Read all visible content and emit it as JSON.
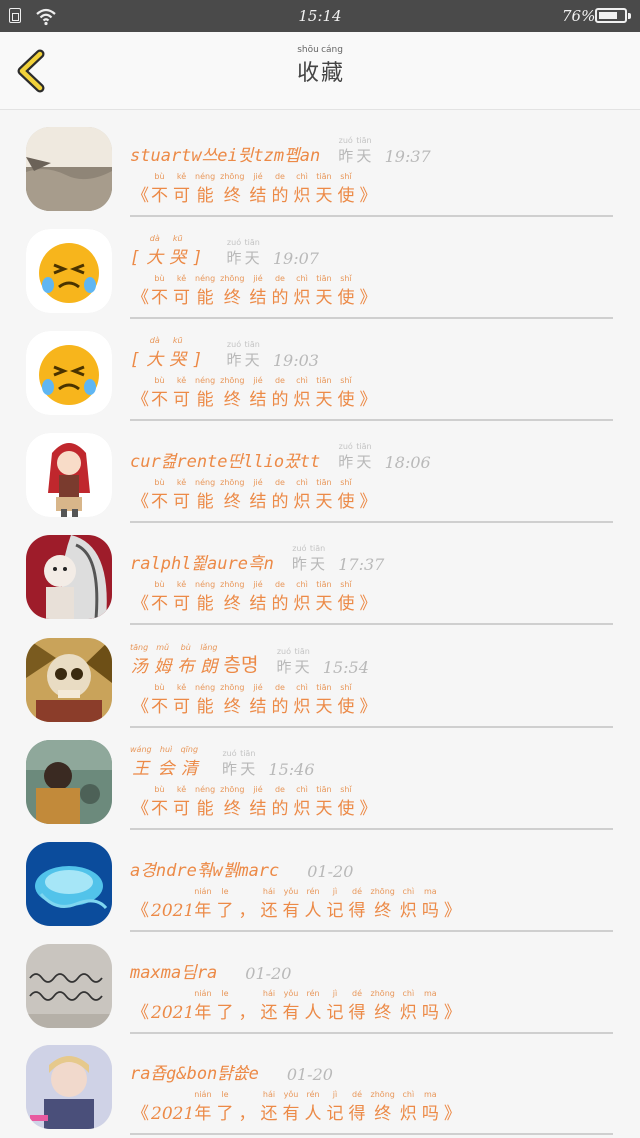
{
  "status_bar": {
    "time": "15:14",
    "battery": "76%",
    "battery_level": 0.76
  },
  "header": {
    "title_chars": [
      {
        "py": "shōu",
        "ch": "收"
      },
      {
        "py": "cáng",
        "ch": "藏"
      }
    ],
    "back_icon": "chevron-left-icon"
  },
  "colors": {
    "accent": "#ec8a47",
    "back_icon": "#f2d23a",
    "muted": "#b8b8b8"
  },
  "yesterday": [
    {
      "py": "zuó",
      "ch": "昨"
    },
    {
      "py": "tiān",
      "ch": "天"
    }
  ],
  "msg_angel": {
    "open": "《",
    "chars": [
      {
        "py": "bù",
        "ch": "不"
      },
      {
        "py": "kě",
        "ch": "可"
      },
      {
        "py": "néng",
        "ch": "能"
      },
      {
        "py": "zhōng",
        "ch": "终"
      },
      {
        "py": "jié",
        "ch": "结"
      },
      {
        "py": "de",
        "ch": "的"
      },
      {
        "py": "chì",
        "ch": "炽"
      },
      {
        "py": "tiān",
        "ch": "天"
      },
      {
        "py": "shǐ",
        "ch": "使"
      }
    ],
    "close": "》"
  },
  "msg_2021": {
    "open": "《",
    "num": "2021",
    "chars": [
      {
        "py": "nián",
        "ch": "年"
      },
      {
        "py": "le",
        "ch": "了"
      },
      {
        "py": "",
        "ch": "，"
      },
      {
        "py": "hái",
        "ch": "还"
      },
      {
        "py": "yǒu",
        "ch": "有"
      },
      {
        "py": "rén",
        "ch": "人"
      },
      {
        "py": "jì",
        "ch": "记"
      },
      {
        "py": "dé",
        "ch": "得"
      },
      {
        "py": "zhōng",
        "ch": "终"
      },
      {
        "py": "chì",
        "ch": "炽"
      },
      {
        "py": "ma",
        "ch": "吗"
      }
    ],
    "close": "》"
  },
  "items": [
    {
      "name": "stuartw쓰ei뮛tzm폡an",
      "show_yesterday": true,
      "time": "19:37",
      "msg": "angel",
      "avatar": "photo"
    },
    {
      "name_chars": [
        {
          "py": "",
          "ch": "["
        },
        {
          "py": "dà",
          "ch": "大"
        },
        {
          "py": "kū",
          "ch": "哭"
        },
        {
          "py": "",
          "ch": "]"
        }
      ],
      "show_yesterday": true,
      "time": "19:07",
      "msg": "angel",
      "avatar": "emoji-cry"
    },
    {
      "name_chars": [
        {
          "py": "",
          "ch": "["
        },
        {
          "py": "dà",
          "ch": "大"
        },
        {
          "py": "kū",
          "ch": "哭"
        },
        {
          "py": "",
          "ch": "]"
        }
      ],
      "show_yesterday": true,
      "time": "19:03",
      "msg": "angel",
      "avatar": "emoji-cry"
    },
    {
      "name": "cur켪rente딴llio꿌tt",
      "show_yesterday": true,
      "time": "18:06",
      "msg": "angel",
      "avatar": "anime-girl"
    },
    {
      "name": "ralphl쬝aure흑n",
      "show_yesterday": true,
      "time": "17:37",
      "msg": "angel",
      "avatar": "ink-girl"
    },
    {
      "name_chars": [
        {
          "py": "tāng",
          "ch": "汤"
        },
        {
          "py": "mǔ",
          "ch": "姆"
        },
        {
          "py": "bù",
          "ch": "布"
        },
        {
          "py": "lǎng",
          "ch": "朗"
        }
      ],
      "name_suffix": "층명",
      "show_yesterday": true,
      "time": "15:54",
      "msg": "angel",
      "avatar": "skull-art"
    },
    {
      "name_chars": [
        {
          "py": "wáng",
          "ch": "王"
        },
        {
          "py": "huì",
          "ch": "会"
        },
        {
          "py": "qīng",
          "ch": "清"
        }
      ],
      "show_yesterday": true,
      "time": "15:46",
      "msg": "angel",
      "avatar": "child-photo"
    },
    {
      "name": "a경ndre훢w뷁marc",
      "show_yesterday": false,
      "time": "01-20",
      "msg": "2021",
      "avatar": "jellyfish"
    },
    {
      "name": "maxma딤ra",
      "show_yesterday": false,
      "time": "01-20",
      "msg": "2021",
      "avatar": "handwriting"
    },
    {
      "name": "ra죱g&bon턁쑚e",
      "show_yesterday": false,
      "time": "01-20",
      "msg": "2021",
      "avatar": "portrait"
    }
  ]
}
